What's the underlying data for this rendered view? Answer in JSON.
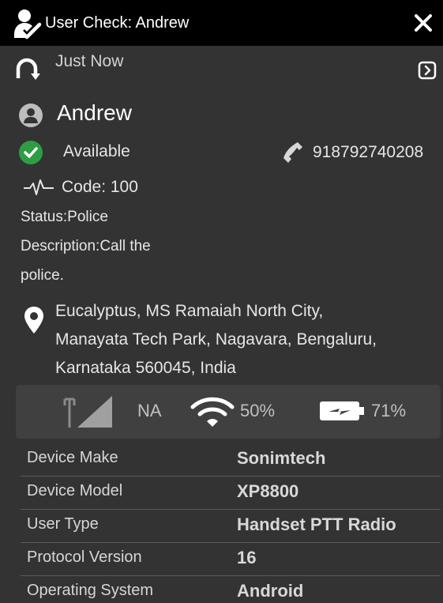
{
  "titlebar": {
    "title": "User Check: Andrew"
  },
  "refresh": {
    "label": "Just Now"
  },
  "user": {
    "name": "Andrew",
    "availability": "Available",
    "phone": "918792740208",
    "code": "Code: 100",
    "status": "Status:Police",
    "description_line1": "Description:Call the",
    "description_line2": "police."
  },
  "address": {
    "line1": "Eucalyptus, MS Ramaiah North City,",
    "line2": "Manayata Tech Park, Nagavara, Bengaluru,",
    "line3": "Karnataka 560045, India"
  },
  "device_stats": {
    "signal": "NA",
    "wifi": "50%",
    "battery": "71%"
  },
  "device_info": [
    {
      "label": "Device Make",
      "value": "Sonimtech"
    },
    {
      "label": "Device Model",
      "value": "XP8800"
    },
    {
      "label": "User Type",
      "value": "Handset PTT Radio"
    },
    {
      "label": "Protocol Version",
      "value": "16"
    },
    {
      "label": "Operating System",
      "value": "Android"
    }
  ],
  "colors": {
    "panel_bg": "#333333",
    "titlebar_bg": "#000000",
    "available_green": "#2e9e44",
    "stats_bg": "#404040"
  },
  "icons": {
    "title": "user-check-icon",
    "close": "close-icon",
    "refresh": "refresh-icon",
    "expand": "expand-icon",
    "avatar": "user-avatar-icon",
    "available": "check-circle-icon",
    "phone": "phone-icon",
    "code": "pulse-icon",
    "address": "map-pin-icon",
    "signal": "cell-signal-icon",
    "wifi": "wifi-icon",
    "battery": "battery-charging-icon"
  }
}
